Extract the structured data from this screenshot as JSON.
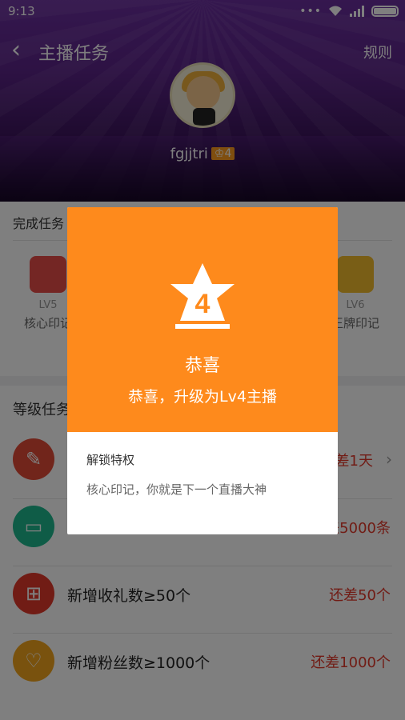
{
  "status_bar": {
    "time": "9:13",
    "dots": "•••",
    "wifi_icon": "wifi-icon",
    "signal_icon": "signal-icon",
    "battery_icon": "battery-icon"
  },
  "nav": {
    "back_icon": "chevron-left-icon",
    "title": "主播任务",
    "rules_label": "规则"
  },
  "profile": {
    "username": "fgjjtri",
    "level_badge": "4"
  },
  "done_section": {
    "title": "完成任务",
    "rewards": [
      {
        "level": "LV5",
        "name": "核心印记"
      },
      {
        "level": "LV6",
        "name": "王牌印记"
      }
    ]
  },
  "level_section": {
    "title": "等级任务",
    "tasks": [
      {
        "icon": "pencil-icon",
        "label": "",
        "status": "还差1天",
        "color": "#e34b36"
      },
      {
        "icon": "chat-bubble-icon",
        "label": "",
        "status": "还差5000条",
        "color": "#1fb88f"
      },
      {
        "icon": "gift-icon",
        "label": "新增收礼数≥50个",
        "status": "还差50个",
        "color": "#e2382a"
      },
      {
        "icon": "heart-icon",
        "label": "新增粉丝数≥1000个",
        "status": "还差1000个",
        "color": "#f3a51c"
      }
    ]
  },
  "dialog": {
    "badge_number": "4",
    "title": "恭喜",
    "subtitle": "恭喜，升级为Lv4主播",
    "unlock_title": "解锁特权",
    "unlock_desc": "核心印记，你就是下一个直播大神",
    "accent_color": "#fe8a1c"
  }
}
